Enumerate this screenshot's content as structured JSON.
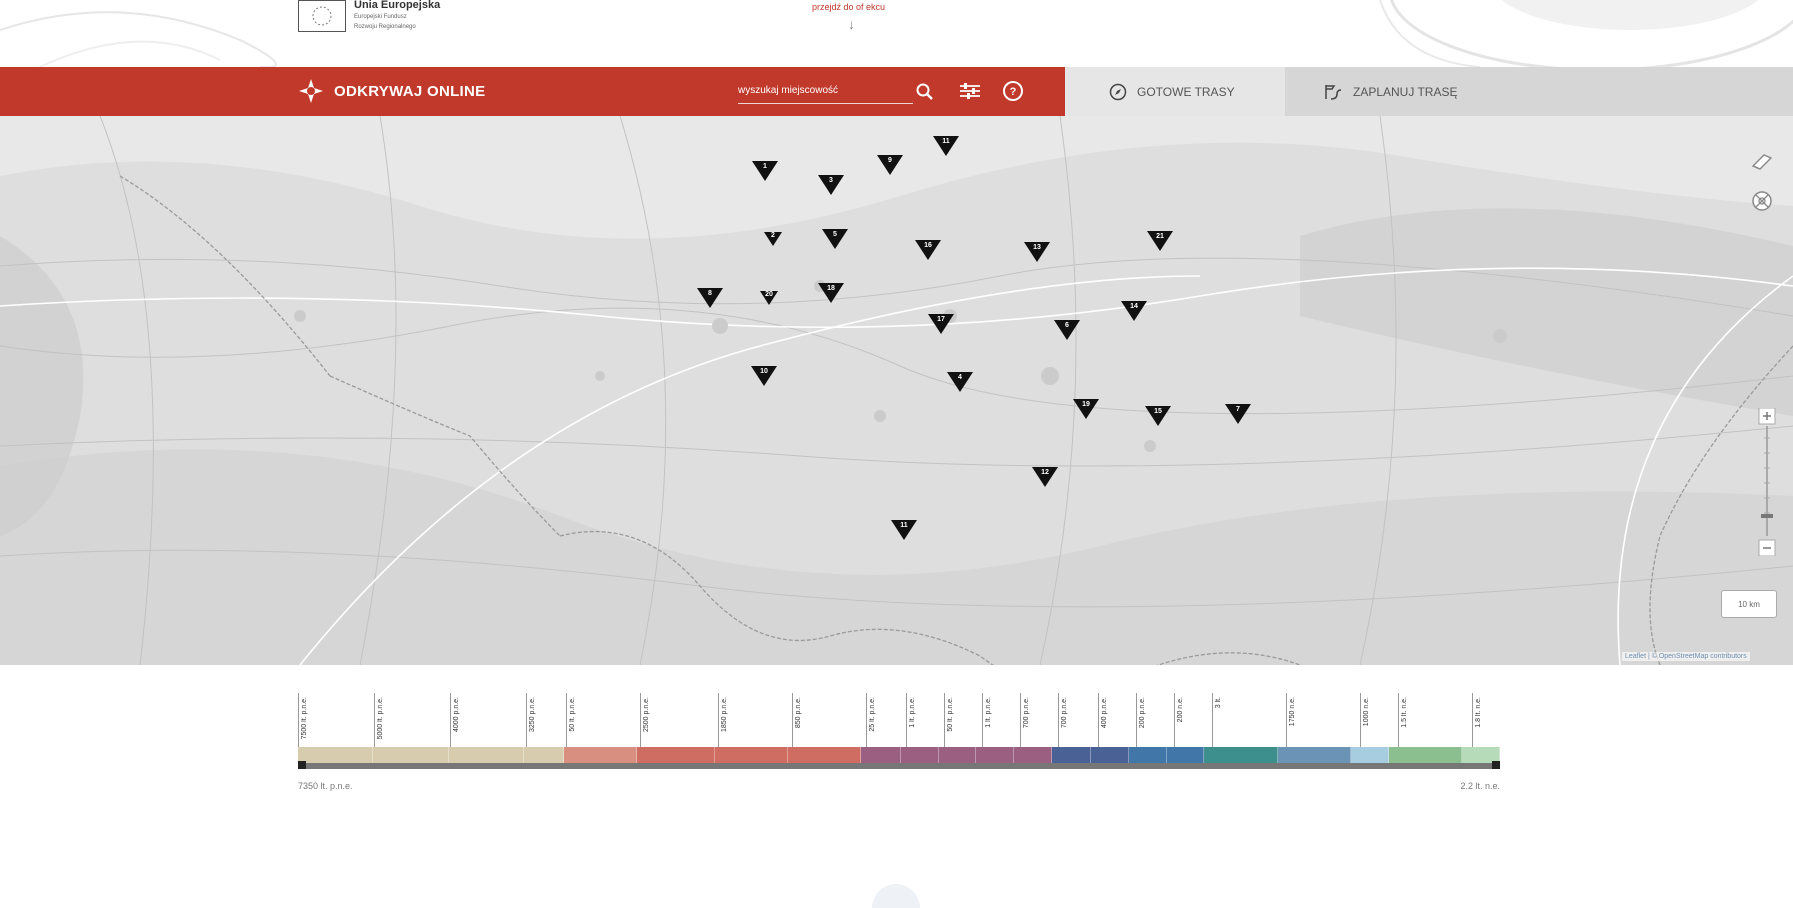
{
  "header": {
    "eu_title": "Unia Europejska",
    "eu_sub_1": "Europejski Fundusz",
    "eu_sub_2": "Rozwoju Regionalnego",
    "skip_link": "przejdź do of ekcu"
  },
  "nav": {
    "brand": "ODKRYWAJ ONLINE",
    "search_placeholder": "wyszukaj miejscowość",
    "tab_ready": "GOTOWE TRASY",
    "tab_plan": "ZAPLANUJ TRASĘ",
    "accent": "#c0392b"
  },
  "map": {
    "markers": [
      "1",
      "3",
      "9",
      "11",
      "2",
      "5",
      "16",
      "13",
      "21",
      "8",
      "20",
      "18",
      "17",
      "6",
      "14",
      "10",
      "4",
      "19",
      "15",
      "7",
      "12"
    ],
    "scale_label": "10 km",
    "attribution": "Leaflet | © OpenStreetMap contributors"
  },
  "timeline": {
    "start_label": "7350 lt. p.n.e.",
    "end_label": "2.2 lt. n.e.",
    "ticks": [
      "7500 lt. p.n.e.",
      "5000 lt. p.n.e.",
      "4000 p.n.e.",
      "3250 p.n.e.",
      "50 lt. p.n.e.",
      "2500 p.n.e.",
      "1850 p.n.e.",
      "850 p.n.e.",
      "25 lt. p.n.e.",
      "1 lt. p.n.e.",
      "50 lt. p.n.e.",
      "1 lt. p.n.e.",
      "700 p.n.e.",
      "700 p.n.e.",
      "400 p.n.e.",
      "200 p.n.e.",
      "200 n.e.",
      "3 lt.",
      "1750 n.e.",
      "1000 n.e.",
      "1.5 lt. n.e.",
      "1.8 lt. n.e."
    ],
    "segment_colors": [
      "#d8ccae",
      "#d8ccae",
      "#d8ccae",
      "#d8ccae",
      "#d98f80",
      "#cf6d62",
      "#cf6d62",
      "#cf6d62",
      "#9b5f81",
      "#9b5f81",
      "#9b5f81",
      "#9b5f81",
      "#9b5f81",
      "#4a6196",
      "#4a6196",
      "#4176a8",
      "#4176a8",
      "#3d8f8d",
      "#6b93b5",
      "#a7cde0",
      "#8bbf90",
      "#b6dbb8"
    ]
  }
}
